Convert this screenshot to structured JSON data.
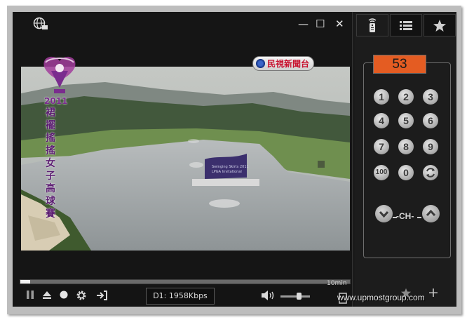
{
  "window": {
    "minimize_label": "—",
    "maximize_label": "☐",
    "close_label": "✕"
  },
  "overlay": {
    "channel_name": "民視新聞台",
    "event_year": "2011",
    "event_title": "裙襬搖搖女子高球賽"
  },
  "progress": {
    "position_fraction": 0.03,
    "duration_label": "10min"
  },
  "controls": {
    "bitrate": "D1: 1958Kbps",
    "volume_fraction": 0.65
  },
  "side_tabs": [
    {
      "icon": "remote-icon",
      "active": true
    },
    {
      "icon": "list-icon",
      "active": false
    },
    {
      "icon": "star-icon",
      "active": false
    }
  ],
  "remote": {
    "channel_number": "53",
    "keys": [
      "1",
      "2",
      "3",
      "4",
      "5",
      "6",
      "7",
      "8",
      "9",
      "100",
      "0"
    ],
    "channel_label": "-CH-"
  },
  "footer": {
    "watermark": "www.upmostgroup.com"
  }
}
